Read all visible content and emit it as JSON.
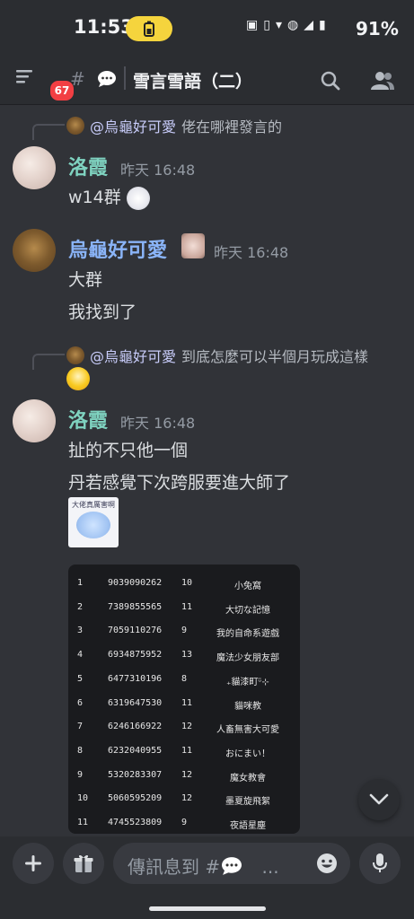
{
  "status": {
    "time": "11:53",
    "battery_pct": "91%"
  },
  "header": {
    "unread_badge": "67",
    "channel_name": "雪言雪語（二）"
  },
  "messages": [
    {
      "reply": {
        "mention": "@烏龜好可愛",
        "text": "佬在哪裡發言的"
      },
      "author": "洛霞",
      "author_color": "#7fd3c0",
      "timestamp": "昨天 16:48",
      "lines": [
        "w14群"
      ]
    },
    {
      "author": "烏龜好可愛",
      "author_color": "#8ab4f8",
      "timestamp": "昨天 16:48",
      "lines": [
        "大群",
        "我找到了"
      ]
    },
    {
      "reply": {
        "mention": "@烏龜好可愛",
        "text": "到底怎麼可以半個月玩成這樣"
      },
      "author": "洛霞",
      "author_color": "#7fd3c0",
      "timestamp": "昨天 16:48",
      "lines": [
        "扯的不只他一個",
        "丹若感覺下次跨服要進大師了"
      ],
      "sticker_caption": "大佬真厲害啊"
    }
  ],
  "ranking": [
    {
      "rank": "1",
      "id": "9039090262",
      "n": "10",
      "name": "小兔窩"
    },
    {
      "rank": "2",
      "id": "7389855565",
      "n": "11",
      "name": "大切な記憶"
    },
    {
      "rank": "3",
      "id": "7059110276",
      "n": "9",
      "name": "我的自命系遊戲"
    },
    {
      "rank": "4",
      "id": "6934875952",
      "n": "13",
      "name": "魔法少女朋友部"
    },
    {
      "rank": "5",
      "id": "6477310196",
      "n": "8",
      "name": "₊貓漆町ᵕ̈⊹"
    },
    {
      "rank": "6",
      "id": "6319647530",
      "n": "11",
      "name": "貓咪教"
    },
    {
      "rank": "7",
      "id": "6246166922",
      "n": "12",
      "name": "人畜無害大可愛"
    },
    {
      "rank": "8",
      "id": "6232040955",
      "n": "11",
      "name": "おにまい！"
    },
    {
      "rank": "9",
      "id": "5320283307",
      "n": "12",
      "name": "魔女教會"
    },
    {
      "rank": "10",
      "id": "5060595209",
      "n": "12",
      "name": "墨夏旋飛絮"
    },
    {
      "rank": "11",
      "id": "4745523809",
      "n": "9",
      "name": "夜語星塵"
    }
  ],
  "composer": {
    "placeholder": "傳訊息到 #",
    "ellipsis": "..."
  }
}
